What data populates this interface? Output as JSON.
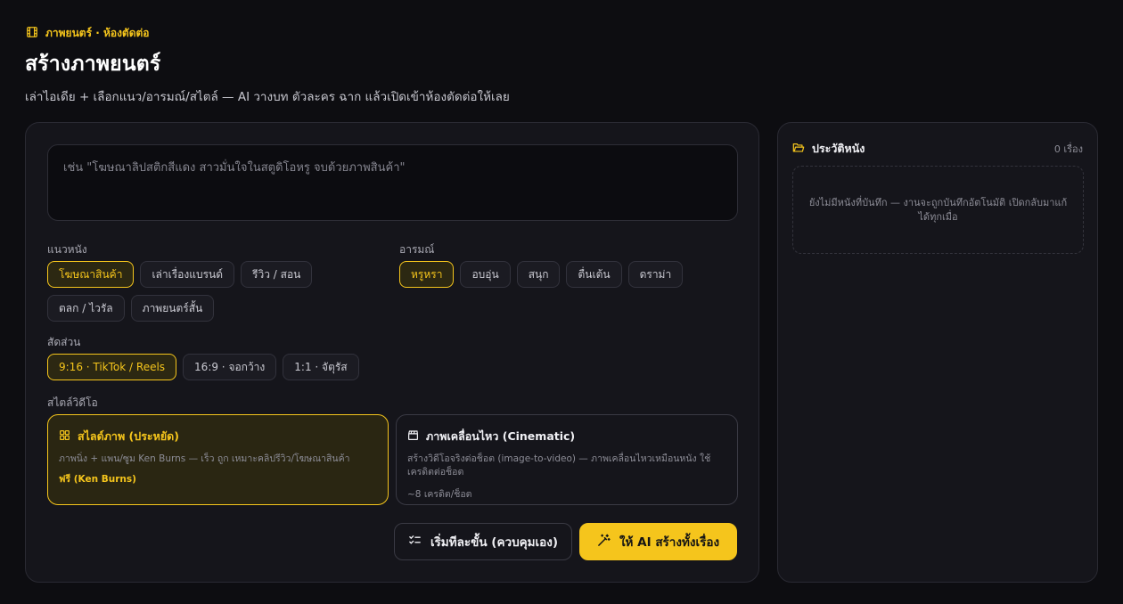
{
  "header": {
    "breadcrumb": "ภาพยนตร์ · ห้องตัดต่อ",
    "title": "สร้างภาพยนตร์",
    "subtitle": "เล่าไอเดีย + เลือกแนว/อารมณ์/สไตล์ — AI วางบท ตัวละคร ฉาก แล้วเปิดเข้าห้องตัดต่อให้เลย"
  },
  "idea": {
    "value": "",
    "placeholder": "เช่น \"โฆษณาลิปสติกสีแดง สาวมั่นใจในสตูดิโอหรู จบด้วยภาพสินค้า\""
  },
  "genre": {
    "label": "แนวหนัง",
    "options": [
      "โฆษณาสินค้า",
      "เล่าเรื่องแบรนด์",
      "รีวิว / สอน",
      "ตลก / ไวรัล",
      "ภาพยนตร์สั้น"
    ],
    "selected": "โฆษณาสินค้า"
  },
  "mood": {
    "label": "อารมณ์",
    "options": [
      "หรูหรา",
      "อบอุ่น",
      "สนุก",
      "ตื่นเต้น",
      "ดราม่า"
    ],
    "selected": "หรูหรา"
  },
  "ratio": {
    "label": "สัดส่วน",
    "options": [
      "9:16 · TikTok / Reels",
      "16:9 · จอกว้าง",
      "1:1 · จัตุรัส"
    ],
    "selected": "9:16 · TikTok / Reels"
  },
  "style": {
    "label": "สไตล์วิดีโอ",
    "cards": [
      {
        "icon": "grid-icon",
        "title": "สไลด์ภาพ (ประหยัด)",
        "desc": "ภาพนิ่ง + แพน/ซูม Ken Burns — เร็ว ถูก เหมาะคลิปรีวิว/โฆษณาสินค้า",
        "price": "ฟรี (Ken Burns)",
        "selected": true
      },
      {
        "icon": "clapperboard-icon",
        "title": "ภาพเคลื่อนไหว (Cinematic)",
        "desc": "สร้างวิดีโอจริงต่อช็อต (image-to-video) — ภาพเคลื่อนไหวเหมือนหนัง ใช้เครดิตต่อช็อต",
        "price": "~8 เครดิต/ช็อต",
        "selected": false
      }
    ]
  },
  "actions": {
    "step_label": "เริ่มทีละขั้น (ควบคุมเอง)",
    "ai_label": "ให้ AI สร้างทั้งเรื่อง"
  },
  "history": {
    "title": "ประวัติหนัง",
    "count": "0 เรื่อง",
    "empty": "ยังไม่มีหนังที่บันทึก — งานจะถูกบันทึกอัตโนมัติ เปิดกลับมาแก้ได้ทุกเมื่อ"
  },
  "colors": {
    "accent": "#f5c51c",
    "background": "#0d0d11",
    "panel": "#15151b"
  }
}
